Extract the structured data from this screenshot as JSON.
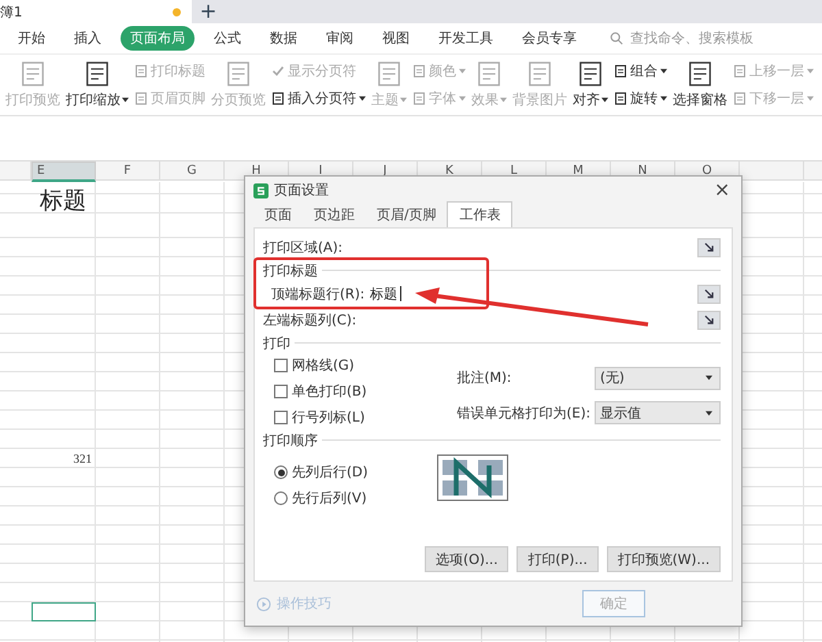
{
  "title_bar": {
    "doc_tab": "簿1",
    "unsaved": true,
    "new_tab": "+"
  },
  "menu": [
    {
      "label": "开始",
      "selected": false
    },
    {
      "label": "插入",
      "selected": false
    },
    {
      "label": "页面布局",
      "selected": true
    },
    {
      "label": "公式",
      "selected": false
    },
    {
      "label": "数据",
      "selected": false
    },
    {
      "label": "审阅",
      "selected": false
    },
    {
      "label": "视图",
      "selected": false
    },
    {
      "label": "开发工具",
      "selected": false
    },
    {
      "label": "会员专享",
      "selected": false
    }
  ],
  "search": {
    "placeholder": "查找命令、搜索模板"
  },
  "ribbon": [
    {
      "kind": "large",
      "label": "打印预览",
      "disabled": true,
      "dropdown": false
    },
    {
      "kind": "large",
      "label": "打印缩放",
      "disabled": false,
      "dropdown": true
    },
    {
      "kind": "stack",
      "items": [
        {
          "kind": "button",
          "label": "打印标题",
          "disabled": true,
          "dropdown": false
        },
        {
          "kind": "button",
          "label": "页眉页脚",
          "disabled": true,
          "dropdown": false
        }
      ]
    },
    {
      "kind": "large",
      "label": "分页预览",
      "disabled": true,
      "dropdown": false
    },
    {
      "kind": "stack",
      "items": [
        {
          "kind": "check",
          "label": "显示分页符",
          "disabled": true,
          "checked": true,
          "dropdown": false
        },
        {
          "kind": "button",
          "label": "插入分页符",
          "disabled": false,
          "dropdown": true
        }
      ]
    },
    {
      "kind": "large",
      "label": "主题",
      "disabled": true,
      "dropdown": true
    },
    {
      "kind": "stack",
      "items": [
        {
          "kind": "button",
          "label": "颜色",
          "disabled": true,
          "dropdown": true
        },
        {
          "kind": "button",
          "label": "字体",
          "disabled": true,
          "dropdown": true
        }
      ]
    },
    {
      "kind": "large",
      "label": "效果",
      "disabled": true,
      "dropdown": true
    },
    {
      "kind": "large",
      "label": "背景图片",
      "disabled": true,
      "dropdown": false
    },
    {
      "kind": "large",
      "label": "对齐",
      "disabled": false,
      "dropdown": true
    },
    {
      "kind": "stack",
      "items": [
        {
          "kind": "button",
          "label": "组合",
          "disabled": false,
          "dropdown": true
        },
        {
          "kind": "button",
          "label": "旋转",
          "disabled": false,
          "dropdown": true
        }
      ]
    },
    {
      "kind": "large",
      "label": "选择窗格",
      "disabled": false,
      "dropdown": false
    },
    {
      "kind": "stack",
      "items": [
        {
          "kind": "button",
          "label": "上移一层",
          "disabled": true,
          "dropdown": true
        },
        {
          "kind": "button",
          "label": "下移一层",
          "disabled": true,
          "dropdown": true
        }
      ]
    }
  ],
  "sheet": {
    "columns": [
      {
        "label": "E",
        "selected": true,
        "cells": [
          {
            "kind": "heading",
            "text": "标题"
          },
          {
            "kind": "number",
            "text": "321"
          }
        ]
      },
      {
        "label": "F",
        "selected": false
      },
      {
        "label": "G",
        "selected": false
      },
      {
        "label": "H",
        "selected": false
      },
      {
        "label": "I",
        "selected": false
      },
      {
        "label": "J",
        "selected": false
      },
      {
        "label": "K",
        "selected": false
      },
      {
        "label": "L",
        "selected": false
      },
      {
        "label": "M",
        "selected": false
      },
      {
        "label": "N",
        "selected": false
      },
      {
        "label": "O",
        "selected": false
      }
    ]
  },
  "dialog": {
    "title": "页面设置",
    "close": "×",
    "tabs": [
      {
        "label": "页面",
        "selected": false
      },
      {
        "label": "页边距",
        "selected": false
      },
      {
        "label": "页眉/页脚",
        "selected": false
      },
      {
        "label": "工作表",
        "selected": true
      }
    ],
    "print_area_label": "打印区域(A):",
    "print_titles": {
      "heading": "打印标题",
      "top_rows_label": "顶端标题行(R):",
      "top_rows_value": "标题",
      "left_columns_label": "左端标题列(C):"
    },
    "print": {
      "heading": "打印",
      "options": [
        {
          "label": "网格线(G)",
          "checked": false
        },
        {
          "label": "单色打印(B)",
          "checked": false
        },
        {
          "label": "行号列标(L)",
          "checked": false
        }
      ],
      "comments": {
        "label": "批注(M):",
        "value": "(无)"
      },
      "errors": {
        "label": "错误单元格打印为(E):",
        "value": "显示值"
      }
    },
    "page_order": {
      "heading": "打印顺序",
      "options": [
        {
          "label": "先列后行(D)",
          "selected": true
        },
        {
          "label": "先行后列(V)",
          "selected": false
        }
      ]
    },
    "buttons": [
      "选项(O)...",
      "打印(P)...",
      "打印预览(W)..."
    ],
    "tips": "操作技巧",
    "ok": "确定"
  }
}
